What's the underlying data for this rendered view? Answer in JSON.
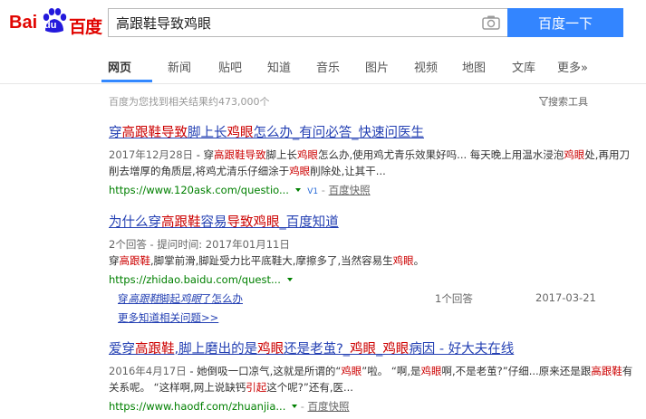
{
  "header": {
    "logo_latin": "Bai",
    "logo_paw_text": "du",
    "logo_cn": "百度",
    "query": "高跟鞋导致鸡眼",
    "search_button": "百度一下"
  },
  "tabs": [
    "网页",
    "新闻",
    "贴吧",
    "知道",
    "音乐",
    "图片",
    "视频",
    "地图",
    "文库",
    "更多»"
  ],
  "result_count": "百度为您找到相关结果约473,000个",
  "search_tools": "搜索工具",
  "colors": {
    "accent": "#3385ff",
    "link": "#2440b3",
    "highlight": "#cc0000",
    "url": "#008000",
    "logo_red": "#e10602",
    "logo_blue": "#2319dc"
  },
  "icons": [
    "camera-icon",
    "funnel-icon",
    "baidu-paw-logo",
    "dropdown-arrow-icon"
  ],
  "results": [
    {
      "title": [
        {
          "t": "穿"
        },
        {
          "t": "高跟鞋",
          "h": true
        },
        {
          "t": "导致",
          "h": true
        },
        {
          "t": "脚上长"
        },
        {
          "t": "鸡眼",
          "h": true
        },
        {
          "t": "怎么办_有问必答_快速问医生"
        }
      ],
      "date": "2017年12月28日",
      "abstract": [
        {
          "t": " - 穿"
        },
        {
          "t": "高跟鞋导致",
          "h": true
        },
        {
          "t": "脚上长"
        },
        {
          "t": "鸡眼",
          "h": true
        },
        {
          "t": "怎么办,使用鸡尤青乐效果好吗... 每天晚上用温水浸泡"
        },
        {
          "t": "鸡眼",
          "h": true
        },
        {
          "t": "处,再用刀削去增厚的角质层,将鸡尤清乐仔细涂于"
        },
        {
          "t": "鸡眼",
          "h": true
        },
        {
          "t": "削除处,让其干..."
        }
      ],
      "url": "https://www.120ask.com/questio...",
      "v1": "V1",
      "kuaizhao": "百度快照"
    },
    {
      "title": [
        {
          "t": "为什么穿"
        },
        {
          "t": "高跟鞋",
          "h": true
        },
        {
          "t": "容易"
        },
        {
          "t": "导致鸡眼",
          "h": true
        },
        {
          "t": "_百度知道"
        }
      ],
      "meta": "2个回答 - 提问时间: 2017年01月11日",
      "abstract": [
        {
          "t": "穿"
        },
        {
          "t": "高跟鞋",
          "h": true
        },
        {
          "t": ",脚掌前滑,脚趾受力比平底鞋大,摩擦多了,当然容易生"
        },
        {
          "t": "鸡眼",
          "h": true
        },
        {
          "t": "。"
        }
      ],
      "url": "https://zhidao.baidu.com/quest...",
      "sub": {
        "link": [
          {
            "t": "穿"
          },
          {
            "t": "高跟鞋",
            "h": true
          },
          {
            "t": "脚起"
          },
          {
            "t": "鸡眼",
            "h": true
          },
          {
            "t": "了怎么办"
          }
        ],
        "answers": "1个回答",
        "date": "2017-03-21"
      },
      "more": "更多知道相关问题>>"
    },
    {
      "title": [
        {
          "t": "爱穿"
        },
        {
          "t": "高跟鞋",
          "h": true
        },
        {
          "t": ",脚上磨出的是"
        },
        {
          "t": "鸡眼",
          "h": true
        },
        {
          "t": "还是老茧?_"
        },
        {
          "t": "鸡眼",
          "h": true
        },
        {
          "t": "_"
        },
        {
          "t": "鸡眼",
          "h": true
        },
        {
          "t": "病因 - 好大夫在线"
        }
      ],
      "date": "2016年4月17日",
      "abstract": [
        {
          "t": " - 她倒吸一口凉气,这就是所谓的“"
        },
        {
          "t": "鸡眼",
          "h": true
        },
        {
          "t": "”啦。 “啊,是"
        },
        {
          "t": "鸡眼",
          "h": true
        },
        {
          "t": "啊,不是老茧?”仔细...原来还是跟"
        },
        {
          "t": "高跟鞋",
          "h": true
        },
        {
          "t": "有关系呢。 “这样啊,网上说缺钙"
        },
        {
          "t": "引起",
          "h": true
        },
        {
          "t": "这个呢?”还有,医..."
        }
      ],
      "url": "https://www.haodf.com/zhuanjia...",
      "kuaizhao": "百度快照"
    }
  ]
}
